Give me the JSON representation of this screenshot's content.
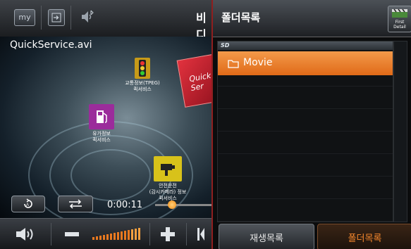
{
  "topbar": {
    "my_label": "my",
    "title_fragment": "비디"
  },
  "video": {
    "filename": "QuickService.avi",
    "timecode": "0:00:11",
    "pois": [
      {
        "label": "교통정보(TPEG)\n퀵서비스"
      },
      {
        "label": "유가정보\n퀵서비스"
      },
      {
        "label": "안전운전\n(감시카메라) 정보\n퀵서비스"
      }
    ],
    "cube_text": "Quick Ser"
  },
  "panel": {
    "title": "폴더목록",
    "first_button_label": "First Detail",
    "storage_label": "SD",
    "folders": [
      {
        "name": "Movie",
        "selected": true
      }
    ],
    "tabs": [
      {
        "label": "재생목록",
        "active": false
      },
      {
        "label": "폴더목록",
        "active": true
      }
    ]
  },
  "colors": {
    "accent": "#e8781f",
    "active_tab_text": "#f5872c"
  }
}
